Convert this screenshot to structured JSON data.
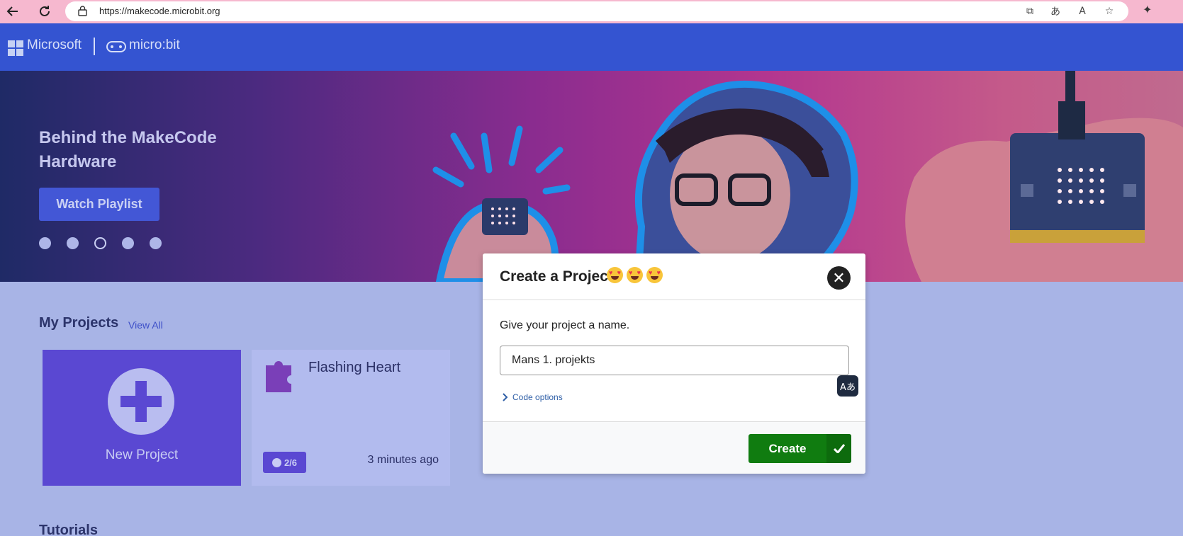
{
  "browser": {
    "url": "https://makecode.microbit.org",
    "tools": [
      "open-in-app-icon",
      "translate-page-icon",
      "read-aloud-icon",
      "favorite-star-icon"
    ],
    "extensions_icon": "puzzle-extensions-icon"
  },
  "header": {
    "brand": "Microsoft",
    "product": "micro:bit"
  },
  "hero": {
    "title": "Behind the MakeCode Hardware",
    "button_label": "Watch Playlist",
    "carousel": {
      "count": 5,
      "active_index": 2
    }
  },
  "projects": {
    "section_title": "My Projects",
    "view_all_label": "View All",
    "new_project_label": "New Project",
    "items": [
      {
        "name": "Flashing Heart",
        "badge": "2/6",
        "time": "3 minutes ago"
      }
    ]
  },
  "tutorials": {
    "section_title": "Tutorials"
  },
  "modal": {
    "title": "Create a Project",
    "emoji_count": 3,
    "prompt": "Give your project a name.",
    "input_value": "Mans 1. projekts",
    "code_options_label": "Code options",
    "translate_glyph": "Aあ",
    "create_label": "Create"
  },
  "colors": {
    "header_bg": "#3454d1",
    "create_green": "#107c10",
    "card_purple": "#5a48d2",
    "page_bg": "#a8b4e6"
  }
}
